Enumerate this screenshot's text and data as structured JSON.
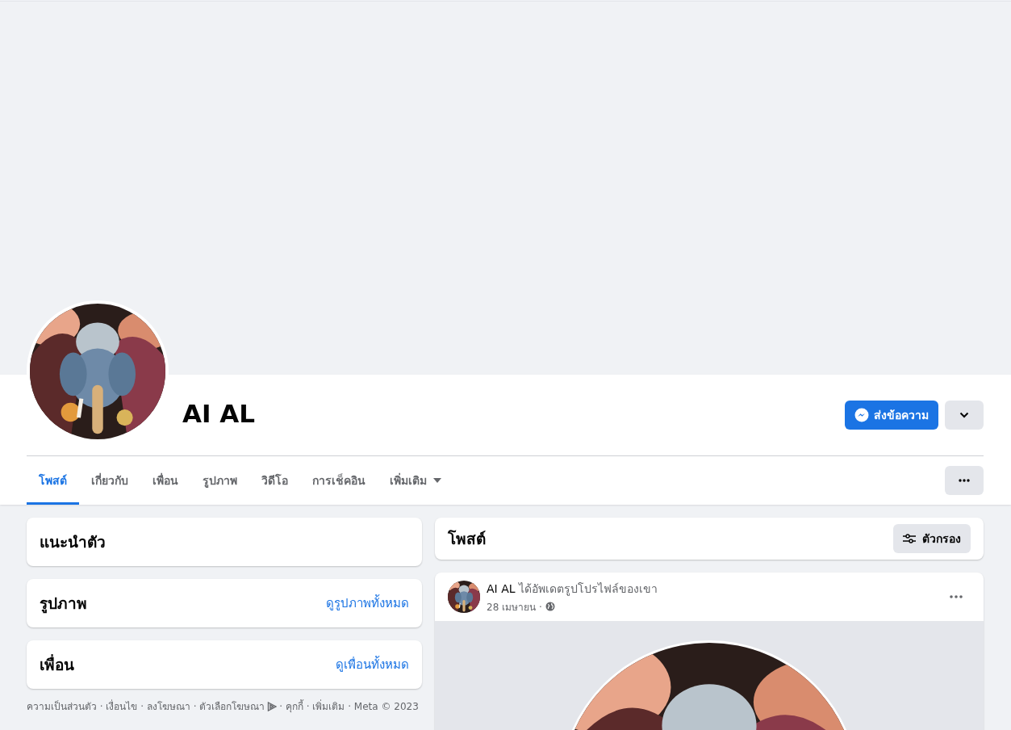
{
  "profile": {
    "name": "AI AL",
    "actions": [
      {
        "kind": "message",
        "label": "ส่งข้อความ"
      },
      {
        "kind": "dropdown"
      }
    ]
  },
  "tabs": [
    {
      "label": "โพสต์",
      "selected": true,
      "kind": "link"
    },
    {
      "label": "เกี่ยวกับ",
      "selected": false,
      "kind": "link"
    },
    {
      "label": "เพื่อน",
      "selected": false,
      "kind": "link"
    },
    {
      "label": "รูปภาพ",
      "selected": false,
      "kind": "link"
    },
    {
      "label": "วิดีโอ",
      "selected": false,
      "kind": "link"
    },
    {
      "label": "การเช็คอิน",
      "selected": false,
      "kind": "link"
    },
    {
      "label": "เพิ่มเติม",
      "selected": false,
      "kind": "menu"
    }
  ],
  "sidebar": {
    "cards": [
      {
        "title": "แนะนำตัว"
      },
      {
        "title": "รูปภาพ",
        "link": "ดูรูปภาพทั้งหมด"
      },
      {
        "title": "เพื่อน",
        "link": "ดูเพื่อนทั้งหมด"
      }
    ],
    "footer": [
      "ความเป็นส่วนตัว · เงื่อนไข · ลงโฆษณา · ตัวเลือกโฆษณา",
      "· คุกกี้ · เพิ่มเติม · Meta © 2023"
    ]
  },
  "posts_header": {
    "title": "โพสต์",
    "filter": "ตัวกรอง"
  },
  "post": {
    "author": "AI AL",
    "action": "ได้อัพเดตรูปโปรไฟล์ของเขา",
    "date": "28 เมษายน ·"
  }
}
